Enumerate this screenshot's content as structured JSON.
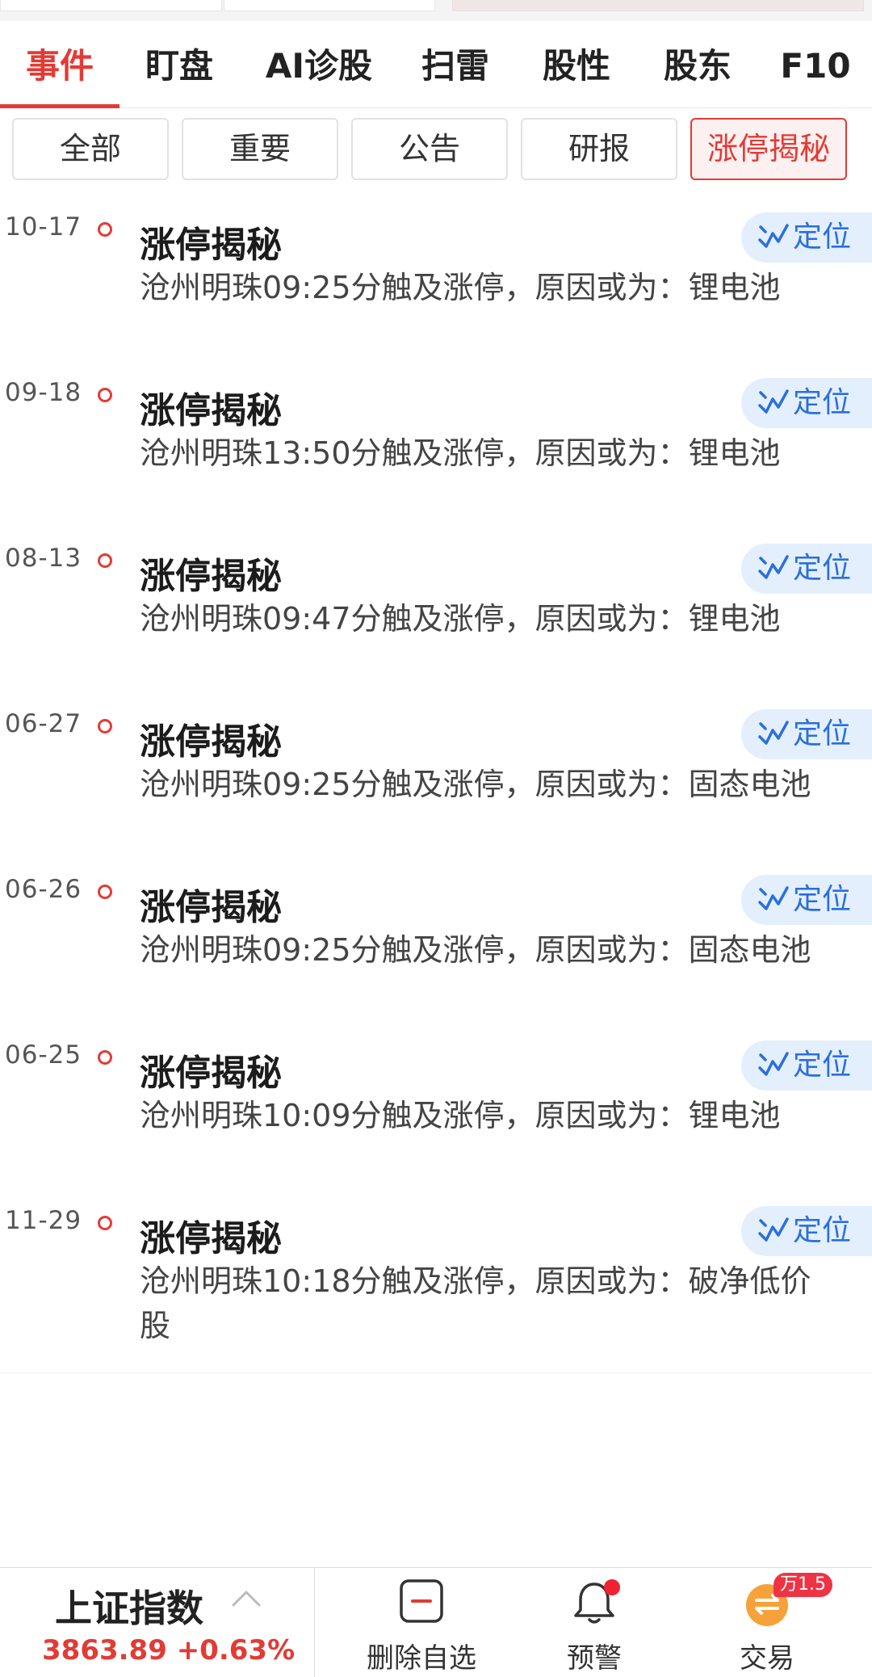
{
  "tabs": [
    {
      "label": "事件",
      "active": true
    },
    {
      "label": "盯盘",
      "active": false
    },
    {
      "label": "AI诊股",
      "active": false
    },
    {
      "label": "扫雷",
      "active": false
    },
    {
      "label": "股性",
      "active": false
    },
    {
      "label": "股东",
      "active": false
    },
    {
      "label": "F10",
      "active": false
    }
  ],
  "filters": [
    {
      "label": "全部",
      "active": false
    },
    {
      "label": "重要",
      "active": false
    },
    {
      "label": "公告",
      "active": false
    },
    {
      "label": "研报",
      "active": false
    },
    {
      "label": "涨停揭秘",
      "active": true
    }
  ],
  "locate_label": "定位",
  "events": [
    {
      "date": "10-17",
      "title": "涨停揭秘",
      "desc": "沧州明珠09:25分触及涨停，原因或为：锂电池"
    },
    {
      "date": "09-18",
      "title": "涨停揭秘",
      "desc": "沧州明珠13:50分触及涨停，原因或为：锂电池"
    },
    {
      "date": "08-13",
      "title": "涨停揭秘",
      "desc": "沧州明珠09:47分触及涨停，原因或为：锂电池"
    },
    {
      "date": "06-27",
      "title": "涨停揭秘",
      "desc": "沧州明珠09:25分触及涨停，原因或为：固态电池"
    },
    {
      "date": "06-26",
      "title": "涨停揭秘",
      "desc": "沧州明珠09:25分触及涨停，原因或为：固态电池"
    },
    {
      "date": "06-25",
      "title": "涨停揭秘",
      "desc": "沧州明珠10:09分触及涨停，原因或为：锂电池"
    },
    {
      "date": "11-29",
      "title": "涨停揭秘",
      "desc": "沧州明珠10:18分触及涨停，原因或为：破净低价股"
    }
  ],
  "bottom": {
    "index_name": "上证指数",
    "index_value": "3863.89 +0.63%",
    "delete_label": "删除自选",
    "alert_label": "预警",
    "trade_label": "交易",
    "trade_badge": "万1.5"
  },
  "colors": {
    "accent": "#e23b35",
    "locate_bg": "#e4effd",
    "locate_text": "#2a6fdc"
  }
}
